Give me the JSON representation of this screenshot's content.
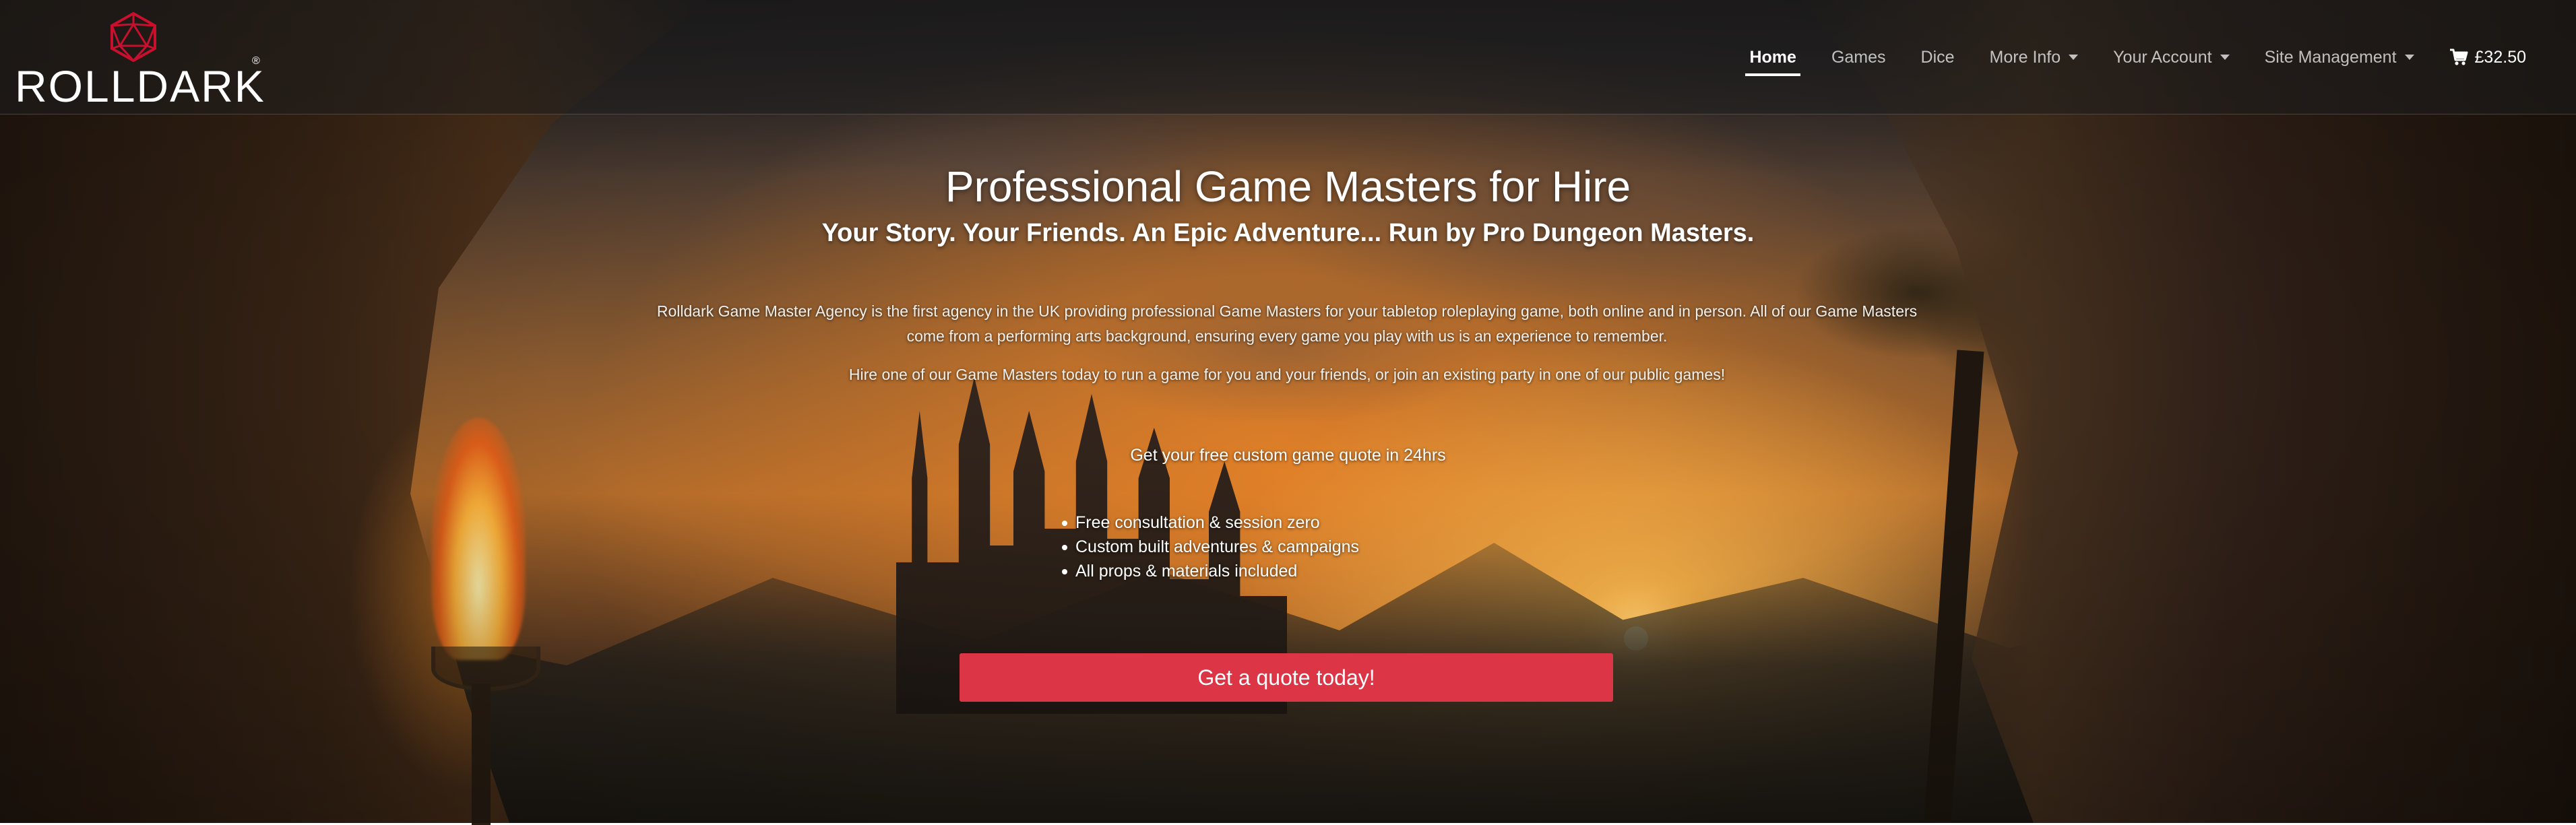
{
  "brand": {
    "name": "ROLLDARK",
    "registered": "®",
    "logo_icon": "d20-dice-icon",
    "logo_color": "#c8102e"
  },
  "nav": {
    "items": [
      {
        "label": "Home",
        "active": true
      },
      {
        "label": "Games"
      },
      {
        "label": "Dice"
      },
      {
        "label": "More Info",
        "dropdown": true
      },
      {
        "label": "Your Account",
        "dropdown": true
      },
      {
        "label": "Site Management",
        "dropdown": true
      }
    ],
    "cart": {
      "icon": "shopping-cart-icon",
      "label": "£32.50"
    }
  },
  "hero": {
    "title": "Professional Game Masters for Hire",
    "subtitle": "Your Story. Your Friends. An Epic Adventure... Run by Pro Dungeon Masters.",
    "body": "Rolldark Game Master Agency is the first agency in the UK providing professional Game Masters for your tabletop roleplaying game, both online and in person. All of our Game Masters come from a performing arts background, ensuring every game you play with us is an experience to remember.",
    "body2": "Hire one of our Game Masters today to run a game for you and your friends, or join an existing party in one of our public games!",
    "quote_heading": "Get your free custom game quote in 24hrs",
    "features": [
      "Free consultation & session zero",
      "Custom built adventures & campaigns",
      "All props & materials included"
    ],
    "cta": "Get a quote today!",
    "cta_color": "#dc3545"
  }
}
